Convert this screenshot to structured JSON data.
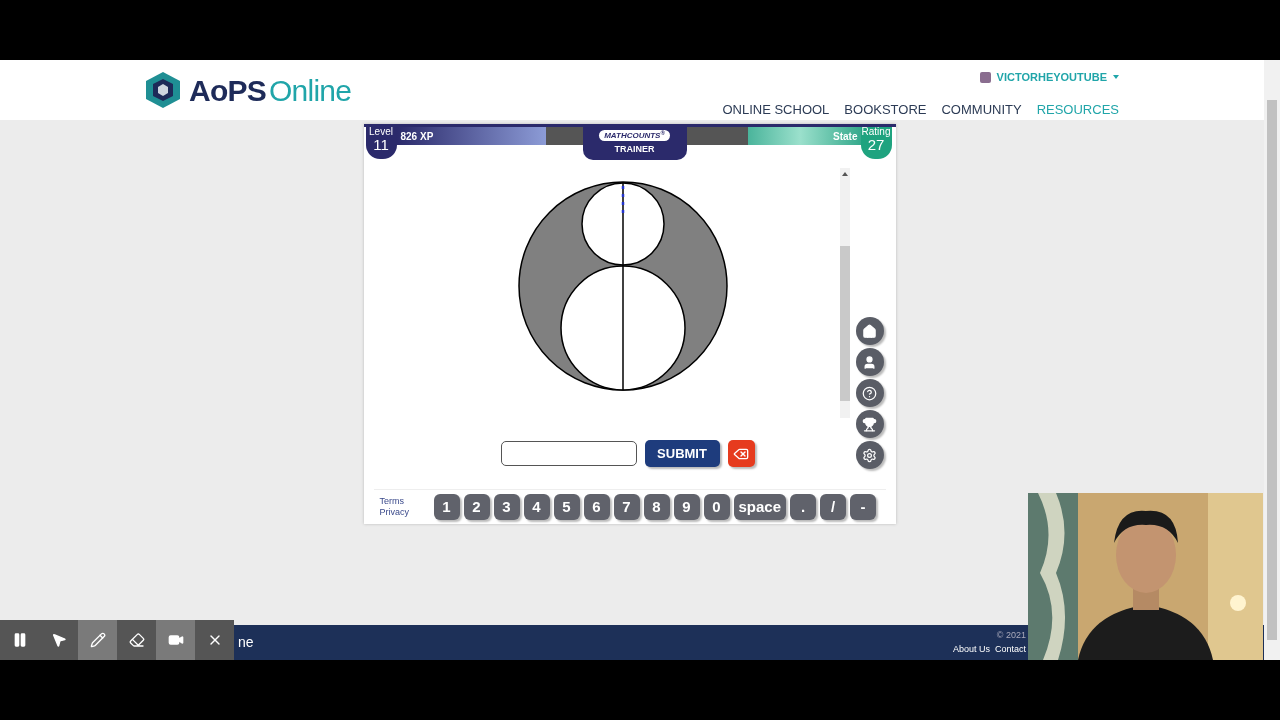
{
  "header": {
    "logo_bold": "AoPS",
    "logo_light": "Online",
    "user": "VICTORHEYOUTUBE",
    "nav": [
      {
        "label": "ONLINE SCHOOL",
        "selected": false
      },
      {
        "label": "BOOKSTORE",
        "selected": false
      },
      {
        "label": "COMMUNITY",
        "selected": false
      },
      {
        "label": "RESOURCES",
        "selected": true
      }
    ]
  },
  "trainer": {
    "level_label": "Level",
    "level": "11",
    "xp": "826 XP",
    "logo_bold": "MATH",
    "logo_rest": "COUNTS",
    "logo_mark": "®",
    "subtitle": "TRAINER",
    "rank": "State",
    "rating_label": "Rating",
    "rating": "27",
    "submit": "SUBMIT",
    "side_buttons": [
      {
        "kind": "home"
      },
      {
        "kind": "user"
      },
      {
        "kind": "help"
      },
      {
        "kind": "trophy"
      },
      {
        "kind": "settings"
      }
    ],
    "links": [
      "Terms",
      "Privacy"
    ],
    "keys": [
      "1",
      "2",
      "3",
      "4",
      "5",
      "6",
      "7",
      "8",
      "9",
      "0",
      "space",
      ".",
      "/",
      "-"
    ]
  },
  "footer": {
    "brand_fragment": "ne",
    "copyright": "© 2021",
    "links": [
      "About Us",
      "Contact"
    ]
  },
  "recorder": {
    "tools": [
      {
        "kind": "pause",
        "selected": false
      },
      {
        "kind": "pointer",
        "selected": false
      },
      {
        "kind": "pen",
        "selected": true
      },
      {
        "kind": "eraser",
        "selected": false
      },
      {
        "kind": "camera",
        "selected": true
      },
      {
        "kind": "close",
        "selected": false
      }
    ]
  }
}
